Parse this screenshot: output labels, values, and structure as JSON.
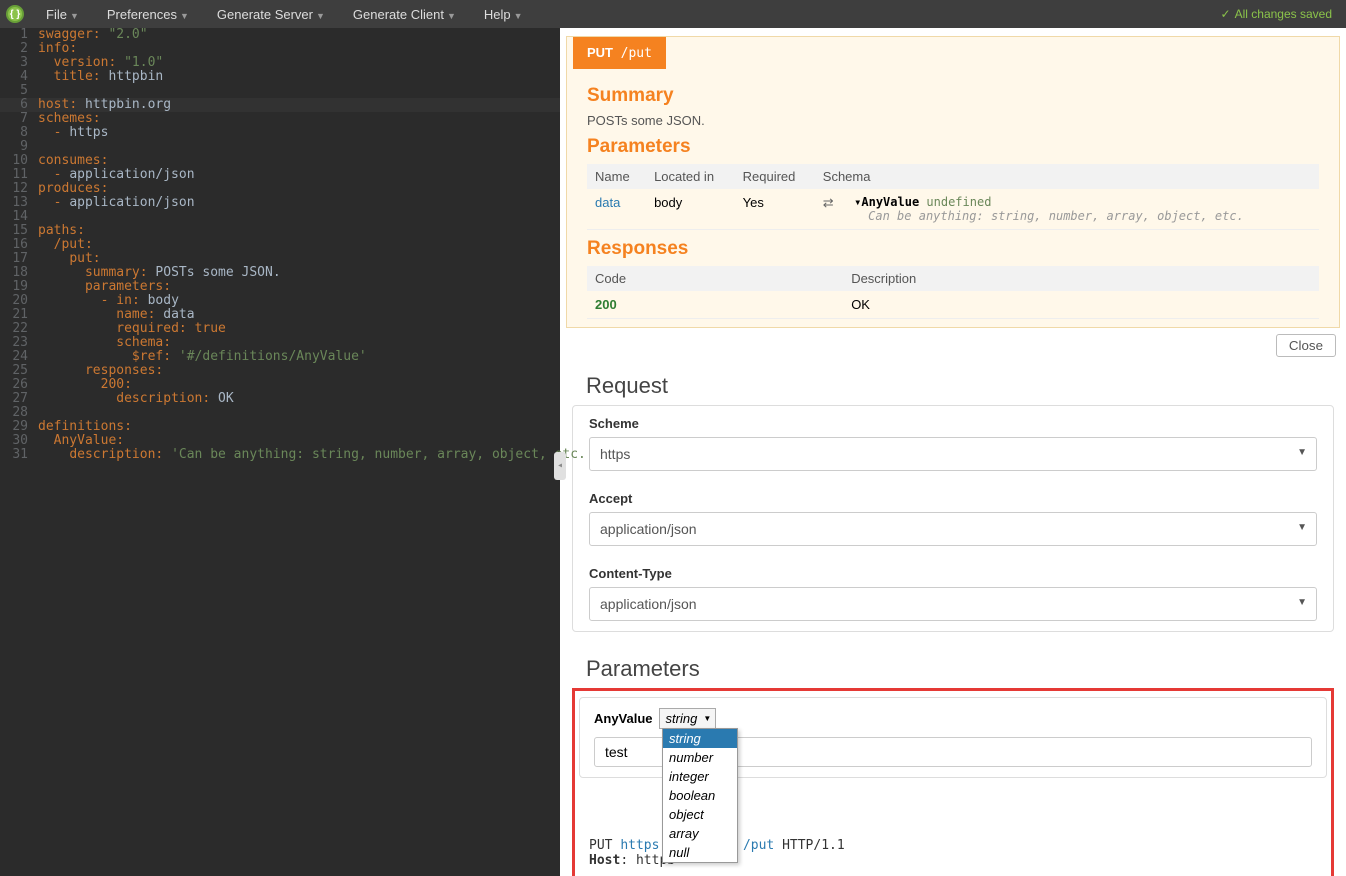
{
  "topbar": {
    "menus": [
      "File",
      "Preferences",
      "Generate Server",
      "Generate Client",
      "Help"
    ],
    "status": "All changes saved"
  },
  "editor": {
    "lines": [
      {
        "n": 1,
        "seg": [
          [
            "key",
            "swagger"
          ],
          [
            "punc",
            ": "
          ],
          [
            "str",
            "\"2.0\""
          ]
        ]
      },
      {
        "n": 2,
        "fold": true,
        "seg": [
          [
            "key",
            "info"
          ],
          [
            "punc",
            ":"
          ]
        ]
      },
      {
        "n": 3,
        "seg": [
          [
            "plain",
            "  "
          ],
          [
            "key",
            "version"
          ],
          [
            "punc",
            ": "
          ],
          [
            "str",
            "\"1.0\""
          ]
        ]
      },
      {
        "n": 4,
        "seg": [
          [
            "plain",
            "  "
          ],
          [
            "key",
            "title"
          ],
          [
            "punc",
            ": "
          ],
          [
            "plain",
            "httpbin"
          ]
        ]
      },
      {
        "n": 5,
        "seg": []
      },
      {
        "n": 6,
        "hl": true,
        "seg": [
          [
            "key",
            "host"
          ],
          [
            "punc",
            ": "
          ],
          [
            "plain",
            "httpbin.org"
          ]
        ]
      },
      {
        "n": 7,
        "fold": true,
        "seg": [
          [
            "key",
            "schemes"
          ],
          [
            "punc",
            ":"
          ]
        ]
      },
      {
        "n": 8,
        "seg": [
          [
            "plain",
            "  "
          ],
          [
            "punc",
            "- "
          ],
          [
            "plain",
            "https"
          ]
        ]
      },
      {
        "n": 9,
        "seg": []
      },
      {
        "n": 10,
        "fold": true,
        "seg": [
          [
            "key",
            "consumes"
          ],
          [
            "punc",
            ":"
          ]
        ]
      },
      {
        "n": 11,
        "seg": [
          [
            "plain",
            "  "
          ],
          [
            "punc",
            "- "
          ],
          [
            "plain",
            "application/json"
          ]
        ]
      },
      {
        "n": 12,
        "fold": true,
        "seg": [
          [
            "key",
            "produces"
          ],
          [
            "punc",
            ":"
          ]
        ]
      },
      {
        "n": 13,
        "seg": [
          [
            "plain",
            "  "
          ],
          [
            "punc",
            "- "
          ],
          [
            "plain",
            "application/json"
          ]
        ]
      },
      {
        "n": 14,
        "seg": []
      },
      {
        "n": 15,
        "fold": true,
        "seg": [
          [
            "key",
            "paths"
          ],
          [
            "punc",
            ":"
          ]
        ]
      },
      {
        "n": 16,
        "fold": true,
        "seg": [
          [
            "plain",
            "  "
          ],
          [
            "key",
            "/put"
          ],
          [
            "punc",
            ":"
          ]
        ]
      },
      {
        "n": 17,
        "fold": true,
        "seg": [
          [
            "plain",
            "    "
          ],
          [
            "key",
            "put"
          ],
          [
            "punc",
            ":"
          ]
        ]
      },
      {
        "n": 18,
        "seg": [
          [
            "plain",
            "      "
          ],
          [
            "key",
            "summary"
          ],
          [
            "punc",
            ": "
          ],
          [
            "plain",
            "POSTs some JSON."
          ]
        ]
      },
      {
        "n": 19,
        "fold": true,
        "seg": [
          [
            "plain",
            "      "
          ],
          [
            "key",
            "parameters"
          ],
          [
            "punc",
            ":"
          ]
        ]
      },
      {
        "n": 20,
        "fold": true,
        "seg": [
          [
            "plain",
            "        "
          ],
          [
            "punc",
            "- "
          ],
          [
            "key",
            "in"
          ],
          [
            "punc",
            ": "
          ],
          [
            "plain",
            "body"
          ]
        ]
      },
      {
        "n": 21,
        "seg": [
          [
            "plain",
            "          "
          ],
          [
            "key",
            "name"
          ],
          [
            "punc",
            ": "
          ],
          [
            "plain",
            "data"
          ]
        ]
      },
      {
        "n": 22,
        "seg": [
          [
            "plain",
            "          "
          ],
          [
            "key",
            "required"
          ],
          [
            "punc",
            ": "
          ],
          [
            "key",
            "true"
          ]
        ]
      },
      {
        "n": 23,
        "fold": true,
        "seg": [
          [
            "plain",
            "          "
          ],
          [
            "key",
            "schema"
          ],
          [
            "punc",
            ":"
          ]
        ]
      },
      {
        "n": 24,
        "seg": [
          [
            "plain",
            "            "
          ],
          [
            "key",
            "$ref"
          ],
          [
            "punc",
            ": "
          ],
          [
            "str",
            "'#/definitions/AnyValue'"
          ]
        ]
      },
      {
        "n": 25,
        "fold": true,
        "seg": [
          [
            "plain",
            "      "
          ],
          [
            "key",
            "responses"
          ],
          [
            "punc",
            ":"
          ]
        ]
      },
      {
        "n": 26,
        "fold": true,
        "seg": [
          [
            "plain",
            "        "
          ],
          [
            "key",
            "200"
          ],
          [
            "punc",
            ":"
          ]
        ]
      },
      {
        "n": 27,
        "seg": [
          [
            "plain",
            "          "
          ],
          [
            "key",
            "description"
          ],
          [
            "punc",
            ": "
          ],
          [
            "plain",
            "OK"
          ]
        ]
      },
      {
        "n": 28,
        "seg": []
      },
      {
        "n": 29,
        "fold": true,
        "seg": [
          [
            "key",
            "definitions"
          ],
          [
            "punc",
            ":"
          ]
        ]
      },
      {
        "n": 30,
        "fold": true,
        "seg": [
          [
            "plain",
            "  "
          ],
          [
            "key",
            "AnyValue"
          ],
          [
            "punc",
            ":"
          ]
        ]
      },
      {
        "n": 31,
        "seg": [
          [
            "plain",
            "    "
          ],
          [
            "key",
            "description"
          ],
          [
            "punc",
            ": "
          ],
          [
            "str",
            "'Can be anything: string, number, array, object, etc.'"
          ]
        ]
      }
    ]
  },
  "op": {
    "method": "PUT",
    "path": "/put",
    "summary_hdr": "Summary",
    "summary_txt": "POSTs some JSON.",
    "params_hdr": "Parameters",
    "params_cols": [
      "Name",
      "Located in",
      "Required",
      "Schema"
    ],
    "param": {
      "name": "data",
      "in": "body",
      "required": "Yes",
      "schema_name": "AnyValue",
      "schema_undef": "undefined",
      "schema_desc": "Can be anything: string, number, array, object, etc."
    },
    "resp_hdr": "Responses",
    "resp_cols": [
      "Code",
      "Description"
    ],
    "resp": {
      "code": "200",
      "desc": "OK"
    },
    "close": "Close"
  },
  "req": {
    "hdr": "Request",
    "scheme_label": "Scheme",
    "scheme_val": "https",
    "accept_label": "Accept",
    "accept_val": "application/json",
    "ct_label": "Content-Type",
    "ct_val": "application/json",
    "params_hdr": "Parameters",
    "anyval_label": "AnyValue",
    "type_selected": "string",
    "type_options": [
      "string",
      "number",
      "integer",
      "boolean",
      "object",
      "array",
      "null"
    ],
    "val_input": "test",
    "raw": {
      "method": "PUT",
      "url": "https://",
      "url2": "/put",
      "proto": " HTTP/1.1",
      "host_label": "Host",
      "host_val": ": httpb"
    }
  }
}
